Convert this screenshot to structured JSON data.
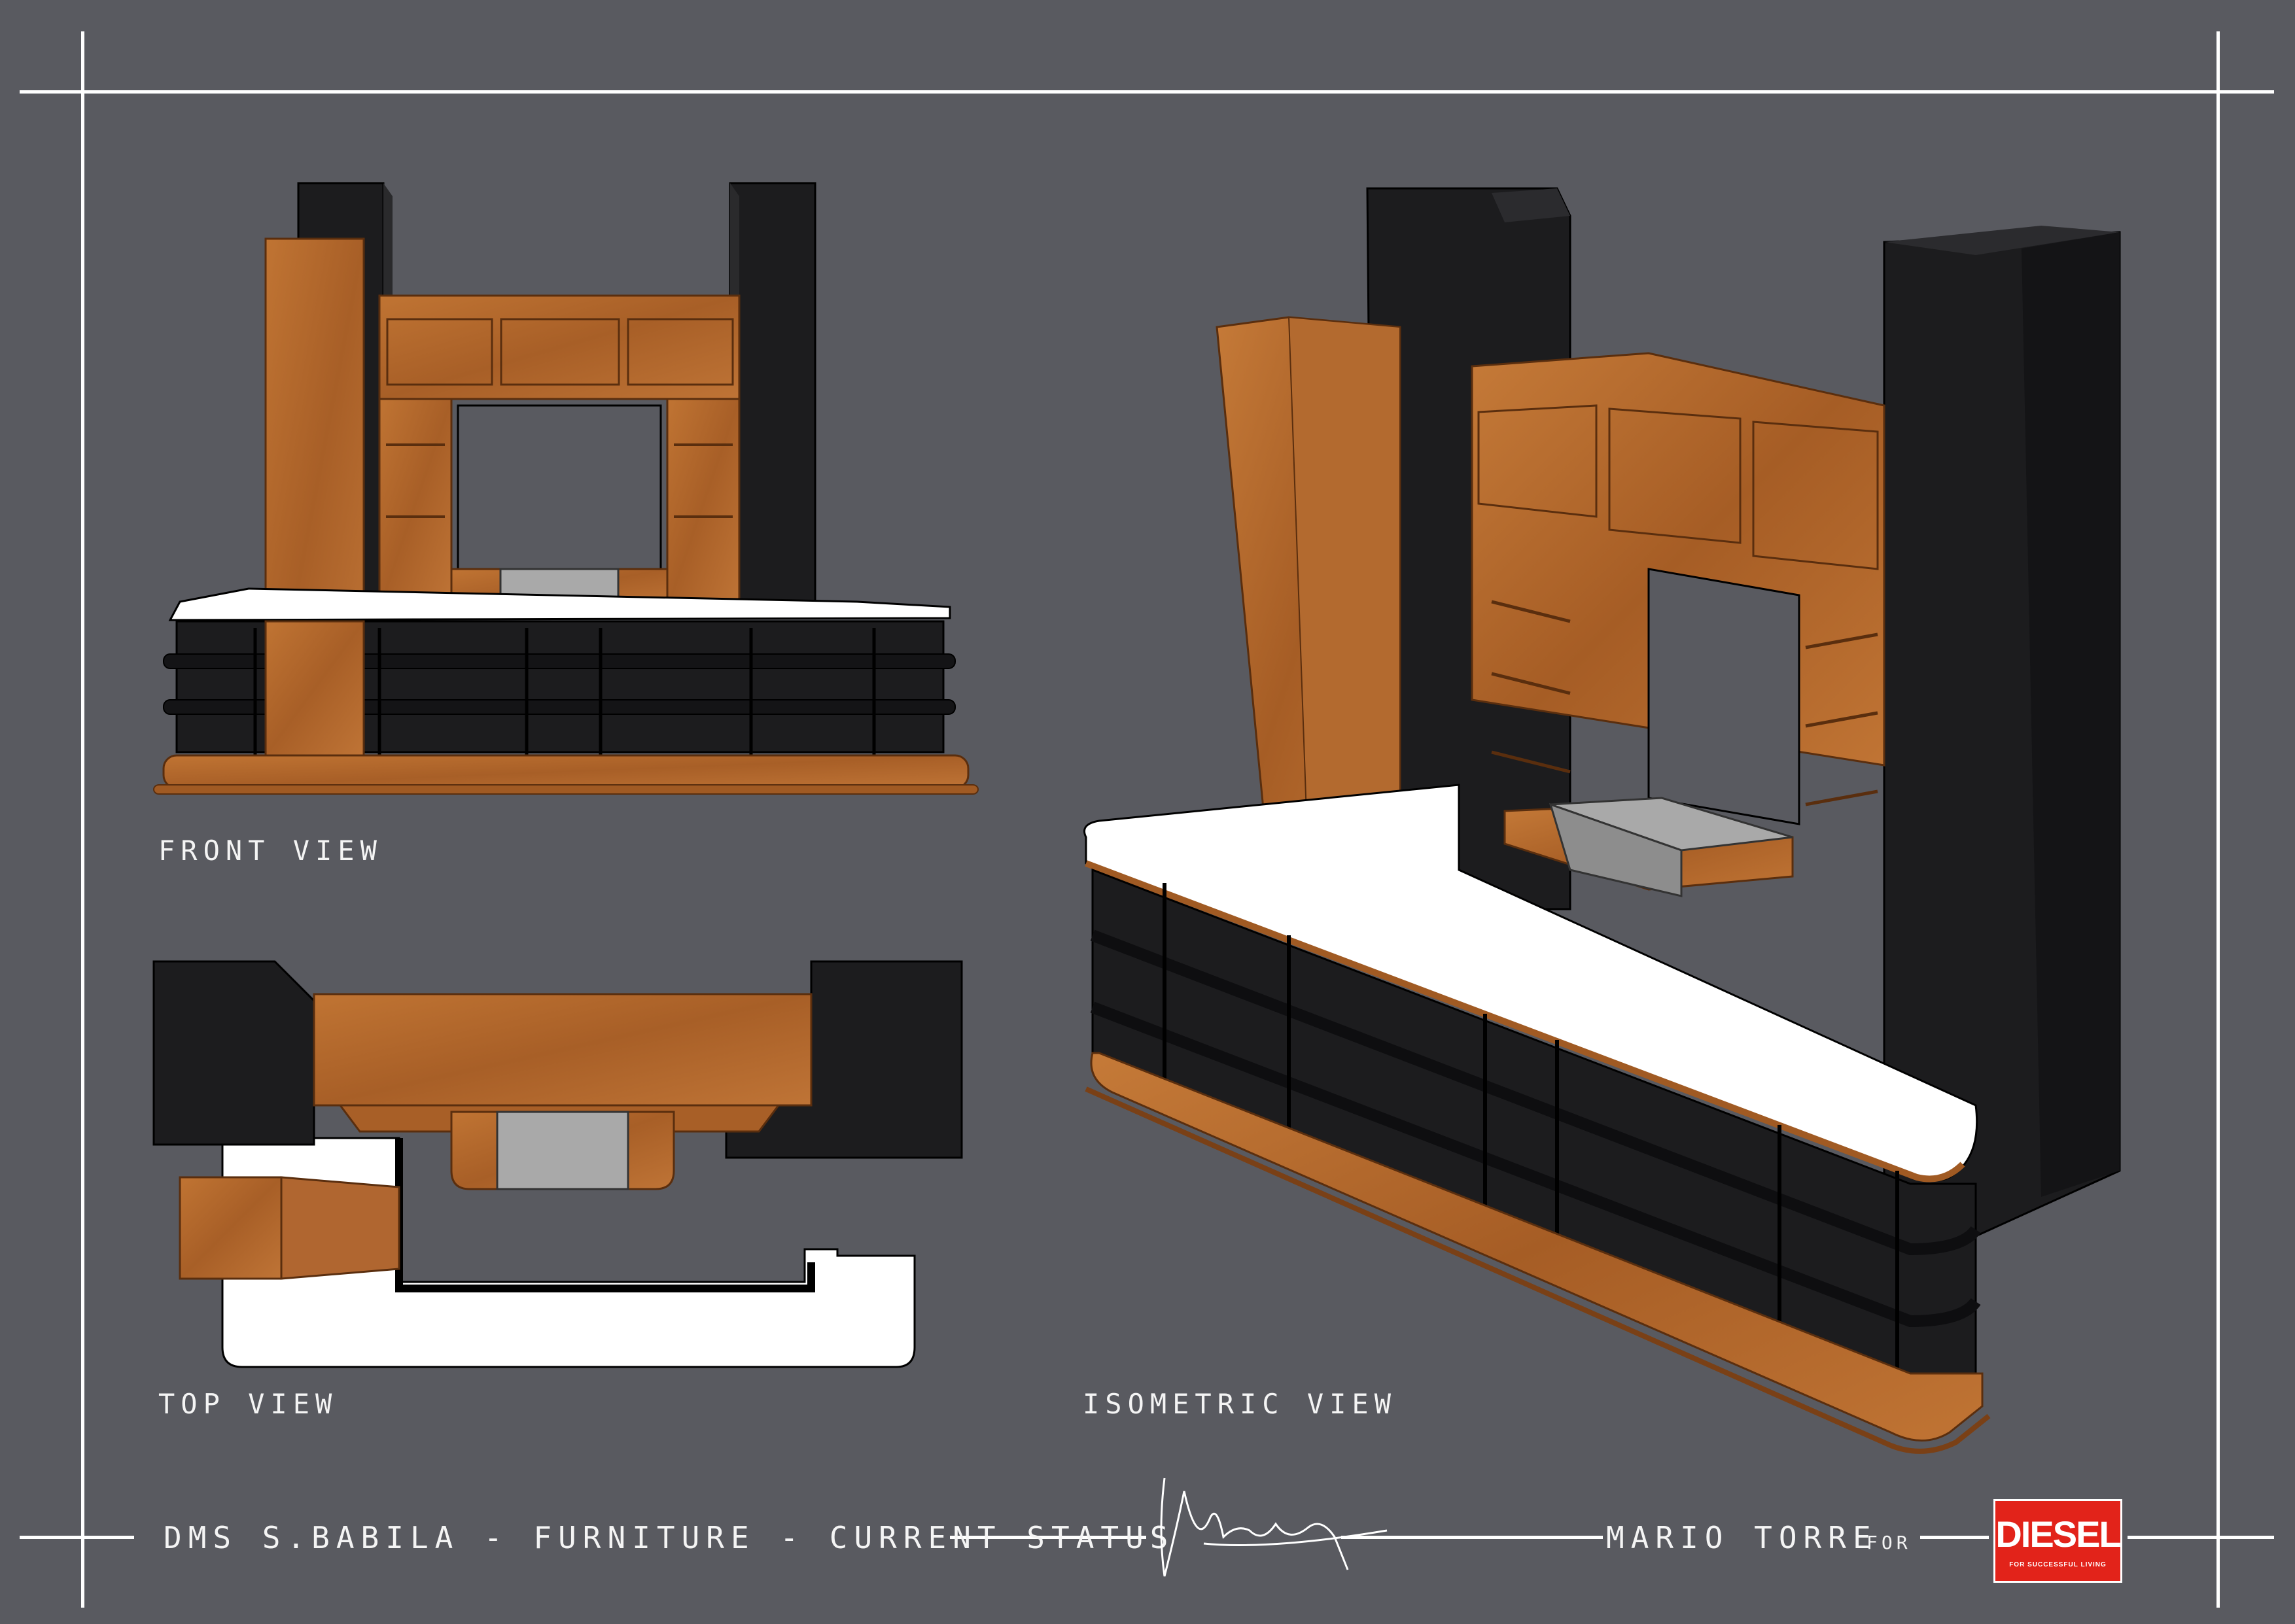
{
  "labels": {
    "front_view": "FRONT VIEW",
    "top_view": "TOP VIEW",
    "isometric_view": "ISOMETRIC VIEW"
  },
  "footer": {
    "project": "DMS S.BABILA - FURNITURE - CURRENT STATUS",
    "designer": "MARIO TORRE",
    "for_word": "FOR"
  },
  "logo": {
    "brand": "DIESEL",
    "tagline": "FOR SUCCESSFUL LIVING"
  },
  "colors": {
    "background": "#595a60",
    "wood": "#b8692e",
    "black": "#1c1c1e",
    "white_top": "#ffffff",
    "sink_grey": "#a9a9a9",
    "brand_red": "#e2231a"
  }
}
